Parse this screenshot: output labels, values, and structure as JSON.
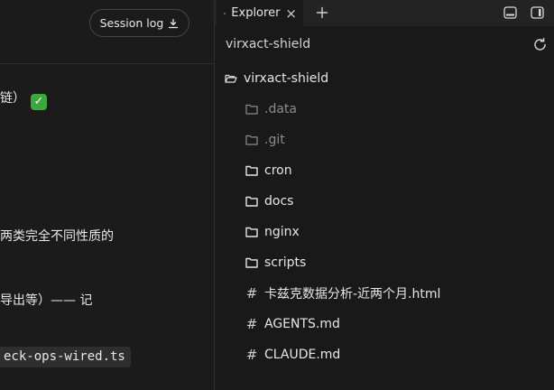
{
  "left_panel": {
    "session_button_label": "Session log",
    "chat_lines": [
      "链）",
      "两类完全不同性质的",
      "导出等）—— 记"
    ],
    "code_snippet": "eck-ops-wired.ts"
  },
  "explorer": {
    "tab_label": "Explorer",
    "tab_close": "×",
    "title": "virxact-shield",
    "root": "virxact-shield",
    "items": [
      {
        "name": ".data",
        "kind": "folder",
        "dim": true
      },
      {
        "name": ".git",
        "kind": "folder",
        "dim": true
      },
      {
        "name": "cron",
        "kind": "folder",
        "dim": false
      },
      {
        "name": "docs",
        "kind": "folder",
        "dim": false
      },
      {
        "name": "nginx",
        "kind": "folder",
        "dim": false
      },
      {
        "name": "scripts",
        "kind": "folder",
        "dim": false
      },
      {
        "name": "卡兹克数据分析-近两个月.html",
        "kind": "file",
        "dim": false
      },
      {
        "name": "AGENTS.md",
        "kind": "file",
        "dim": false
      },
      {
        "name": "CLAUDE.md",
        "kind": "file",
        "dim": false
      }
    ]
  },
  "colors": {
    "background": "#191919",
    "check_green": "#3aa83a",
    "dim_text": "#8c8c8c"
  },
  "icons": [
    "download-icon",
    "check-icon",
    "folder-open-icon",
    "folder-icon",
    "hash-icon",
    "close-icon",
    "plus-icon",
    "panel-bottom-icon",
    "panel-right-icon",
    "refresh-icon"
  ]
}
